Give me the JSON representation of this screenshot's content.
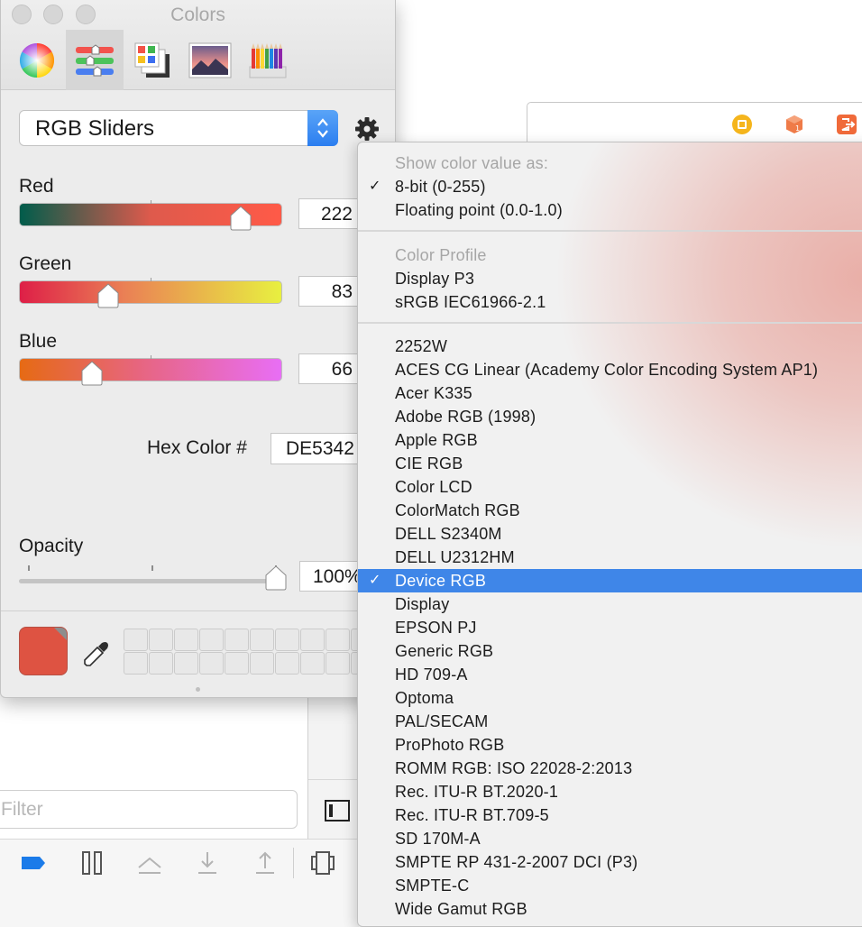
{
  "panel": {
    "title": "Colors",
    "tabs": [
      "color-wheel",
      "color-sliders",
      "color-palettes",
      "image-palettes",
      "pencils"
    ],
    "active_tab": "color-sliders"
  },
  "sliders_mode": {
    "selected": "RGB Sliders"
  },
  "channels": {
    "red": {
      "label": "Red",
      "value": "222"
    },
    "green": {
      "label": "Green",
      "value": "83"
    },
    "blue": {
      "label": "Blue",
      "value": "66"
    }
  },
  "hex": {
    "label": "Hex Color #",
    "value": "DE5342"
  },
  "opacity": {
    "label": "Opacity",
    "value": "100%"
  },
  "current_color": "#de5342",
  "menu": {
    "value_header": "Show color value as:",
    "value_options": [
      "8-bit (0-255)",
      "Floating point (0.0-1.0)"
    ],
    "value_selected": "8-bit (0-255)",
    "profile_header": "Color Profile",
    "profile_options": [
      "Display P3",
      "sRGB IEC61966-2.1"
    ],
    "profiles": [
      "2252W",
      "ACES CG Linear (Academy Color Encoding System AP1)",
      "Acer K335",
      "Adobe RGB (1998)",
      "Apple RGB",
      "CIE RGB",
      "Color LCD",
      "ColorMatch RGB",
      "DELL S2340M",
      "DELL U2312HM",
      "Device RGB",
      "Display",
      "EPSON PJ",
      "Generic RGB",
      "HD 709-A",
      "Optoma",
      "PAL/SECAM",
      "ProPhoto RGB",
      "ROMM RGB: ISO 22028-2:2013",
      "Rec. ITU-R BT.2020-1",
      "Rec. ITU-R BT.709-5",
      "SD 170M-A",
      "SMPTE RP 431-2-2007 DCI (P3)",
      "SMPTE-C",
      "Wide Gamut RGB"
    ],
    "profile_selected": "Device RGB"
  },
  "background": {
    "filter_placeholder": "Filter"
  }
}
